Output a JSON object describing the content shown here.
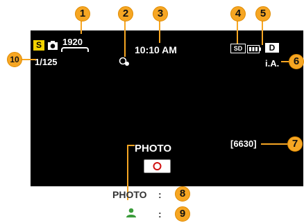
{
  "screen": {
    "resolution": "1920",
    "time": "10:10 AM",
    "media": "SD",
    "battery_state": "D",
    "shutter": "1/125",
    "mode": "i.A.",
    "remaining": "[6630]",
    "record_label": "PHOTO"
  },
  "callouts": {
    "c1": "1",
    "c2": "2",
    "c3": "3",
    "c4": "4",
    "c5": "5",
    "c6": "6",
    "c7": "7",
    "c8": "8",
    "c9": "9",
    "c10": "10"
  },
  "legend": {
    "row1_label": "PHOTO",
    "row1_sep": ":",
    "row2_sep": ":"
  },
  "colors": {
    "accent": "#f6a623",
    "scene_icon": "#f2d200",
    "user_icon": "#3b9c3b"
  }
}
